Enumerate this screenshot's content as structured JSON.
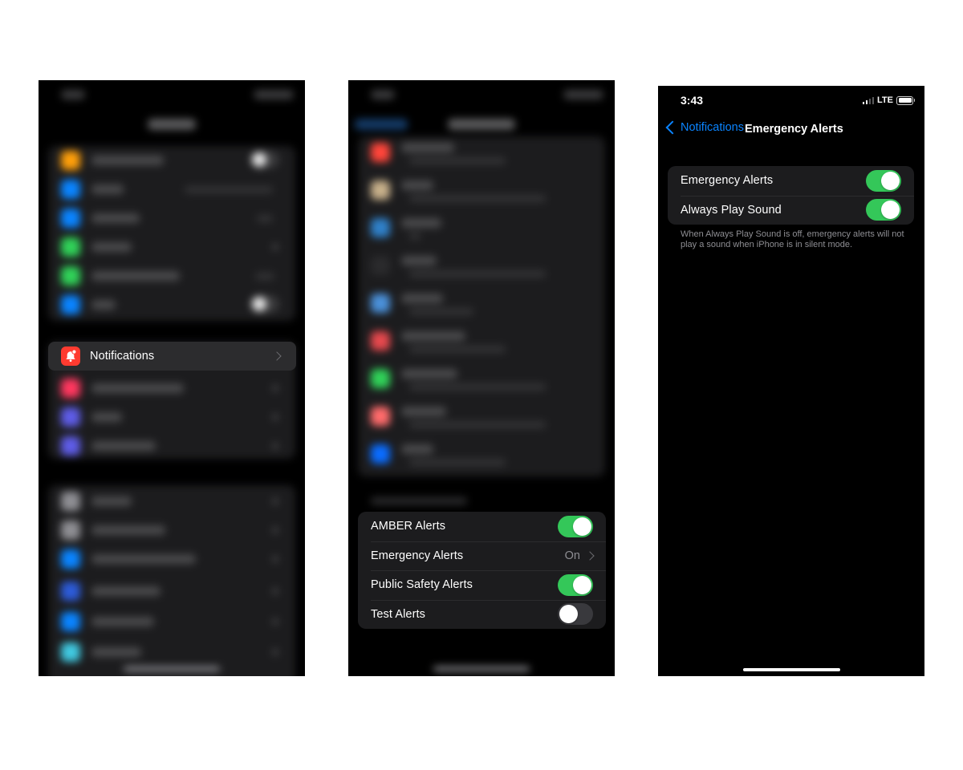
{
  "panel1": {
    "notifications_row": {
      "label": "Notifications"
    }
  },
  "panel2": {
    "alerts_rows": [
      {
        "label": "AMBER Alerts",
        "control": "toggle",
        "state": "on"
      },
      {
        "label": "Emergency Alerts",
        "control": "link",
        "value": "On"
      },
      {
        "label": "Public Safety Alerts",
        "control": "toggle",
        "state": "on"
      },
      {
        "label": "Test Alerts",
        "control": "toggle",
        "state": "off"
      }
    ]
  },
  "panel3": {
    "status": {
      "time": "3:43",
      "network": "LTE"
    },
    "nav": {
      "back_label": "Notifications",
      "title": "Emergency Alerts"
    },
    "rows": [
      {
        "label": "Emergency Alerts",
        "state": "on"
      },
      {
        "label": "Always Play Sound",
        "state": "on"
      }
    ],
    "footer": "When Always Play Sound is off, emergency alerts will not play a sound when iPhone is in silent mode."
  },
  "colors": {
    "toggle_on": "#34c759",
    "toggle_off": "#39393d",
    "link_blue": "#0a84ff",
    "notifications_icon": "#ff3b30"
  },
  "icons": [
    "bell-badge-icon",
    "chevron-right-icon",
    "back-chevron-icon",
    "signal-icon",
    "battery-icon"
  ]
}
